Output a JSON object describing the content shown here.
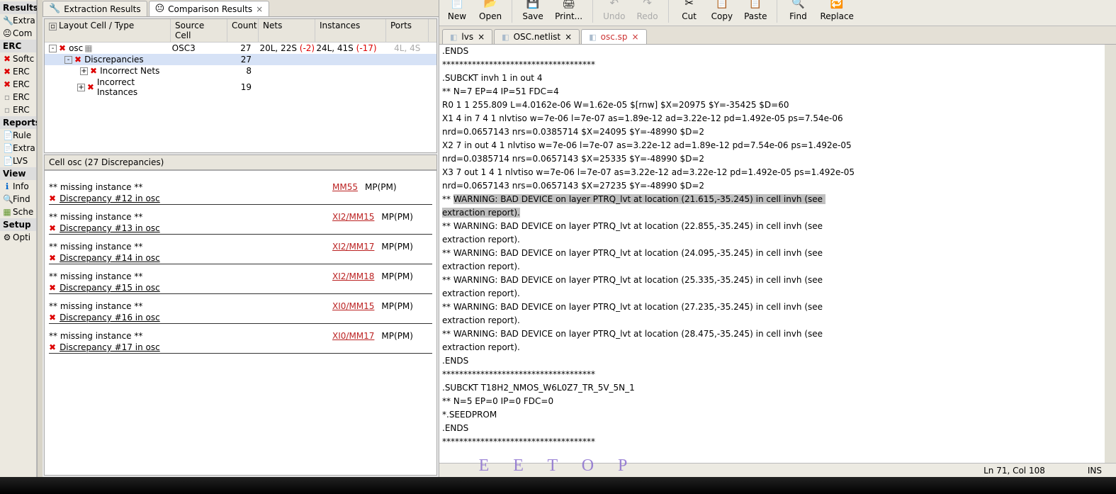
{
  "leftRail": {
    "results_hdr": "Results",
    "extract": "Extra",
    "compare": "Com",
    "erc_hdr": "ERC",
    "soft": "Softc",
    "erc1": "ERC",
    "erc2": "ERC",
    "erc3": "ERC",
    "erc4": "ERC",
    "reports_hdr": "Reports",
    "rule": "Rule",
    "extr": "Extra",
    "lvs": "LVS",
    "view_hdr": "View",
    "info": "Info",
    "find": "Find",
    "sche": "Sche",
    "setup_hdr": "Setup",
    "opti": "Opti"
  },
  "centerTabs": {
    "extraction": "Extraction Results",
    "comparison": "Comparison Results"
  },
  "treeHdr": {
    "layout": "Layout Cell / Type",
    "source": "Source Cell",
    "count": "Count",
    "nets": "Nets",
    "instances": "Instances",
    "ports": "Ports"
  },
  "treeRows": {
    "r0": {
      "name": "osc",
      "src": "OSC3",
      "cnt": "27",
      "nets": "20L, 22S",
      "nets_d": "(-2)",
      "ins": "24L, 41S",
      "ins_d": "(-17)",
      "por": "4L, 4S"
    },
    "r1": {
      "name": "Discrepancies",
      "cnt": "27"
    },
    "r2": {
      "name": "Incorrect Nets",
      "cnt": "8"
    },
    "r3": {
      "name": "Incorrect Instances",
      "cnt": "19"
    }
  },
  "discHdr": "Cell osc (27 Discrepancies)",
  "discItems": [
    {
      "miss": "** missing instance **",
      "link": "MM55",
      "tag": "MP(PM)",
      "line": "Discrepancy #12 in osc"
    },
    {
      "miss": "** missing instance **",
      "link": "XI2/MM15",
      "tag": "MP(PM)",
      "line": "Discrepancy #13 in osc"
    },
    {
      "miss": "** missing instance **",
      "link": "XI2/MM17",
      "tag": "MP(PM)",
      "line": "Discrepancy #14 in osc"
    },
    {
      "miss": "** missing instance **",
      "link": "XI2/MM18",
      "tag": "MP(PM)",
      "line": "Discrepancy #15 in osc"
    },
    {
      "miss": "** missing instance **",
      "link": "XI0/MM15",
      "tag": "MP(PM)",
      "line": "Discrepancy #16 in osc"
    },
    {
      "miss": "** missing instance **",
      "link": "XI0/MM17",
      "tag": "MP(PM)",
      "line": "Discrepancy #17 in osc"
    }
  ],
  "toolbar": {
    "new": "New",
    "open": "Open",
    "save": "Save",
    "print": "Print...",
    "undo": "Undo",
    "redo": "Redo",
    "cut": "Cut",
    "copy": "Copy",
    "paste": "Paste",
    "find": "Find",
    "replace": "Replace"
  },
  "edTabs": {
    "lvs": "lvs",
    "net": "OSC.netlist",
    "osc": "osc.sp"
  },
  "editor": {
    "l1": ".ENDS",
    "l2": "************************************",
    "l3": ".SUBCKT invh 1 in out 4",
    "l4": "** N=7 EP=4 IP=51 FDC=4",
    "l5": "R0 1 1 255.809 L=4.0162e-06 W=1.62e-05 $[rnw] $X=20975 $Y=-35425 $D=60",
    "l6": "X1 4 in 7 4 1 nlvtiso w=7e-06 l=7e-07 as=1.89e-12 ad=3.22e-12 pd=1.492e-05 ps=7.54e-06",
    "l7": "nrd=0.0657143 nrs=0.0385714 $X=24095 $Y=-48990 $D=2",
    "l8": "X2 7 in out 4 1 nlvtiso w=7e-06 l=7e-07 as=3.22e-12 ad=1.89e-12 pd=7.54e-06 ps=1.492e-05",
    "l9": "nrd=0.0385714 nrs=0.0657143 $X=25335 $Y=-48990 $D=2",
    "l10": "X3 7 out 1 4 1 nlvtiso w=7e-06 l=7e-07 as=3.22e-12 ad=3.22e-12 pd=1.492e-05 ps=1.492e-05",
    "l11": "nrd=0.0657143 nrs=0.0657143 $X=27235 $Y=-48990 $D=2",
    "l12a": "** ",
    "l12b": "WARNING: BAD DEVICE on layer PTRQ_lvt at location (21.615,-35.245) in cell invh (see ",
    "l13": "extraction report).",
    "l14": "** WARNING: BAD DEVICE on layer PTRQ_lvt at location (22.855,-35.245) in cell invh (see",
    "l15": "extraction report).",
    "l16": "** WARNING: BAD DEVICE on layer PTRQ_lvt at location (24.095,-35.245) in cell invh (see",
    "l17": "extraction report).",
    "l18": "** WARNING: BAD DEVICE on layer PTRQ_lvt at location (25.335,-35.245) in cell invh (see",
    "l19": "extraction report).",
    "l20": "** WARNING: BAD DEVICE on layer PTRQ_lvt at location (27.235,-35.245) in cell invh (see",
    "l21": "extraction report).",
    "l22": "** WARNING: BAD DEVICE on layer PTRQ_lvt at location (28.475,-35.245) in cell invh (see",
    "l23": "extraction report).",
    "l24": ".ENDS",
    "l25": "************************************",
    "l26": ".SUBCKT T18H2_NMOS_W6L0Z7_TR_5V_5N_1",
    "l27": "** N=5 EP=0 IP=0 FDC=0",
    "l28": "*.SEEDPROM",
    "l29": ".ENDS",
    "l30": "************************************"
  },
  "status": {
    "pos": "Ln 71, Col 108",
    "ins": "INS"
  },
  "watermark": "E E T O P"
}
